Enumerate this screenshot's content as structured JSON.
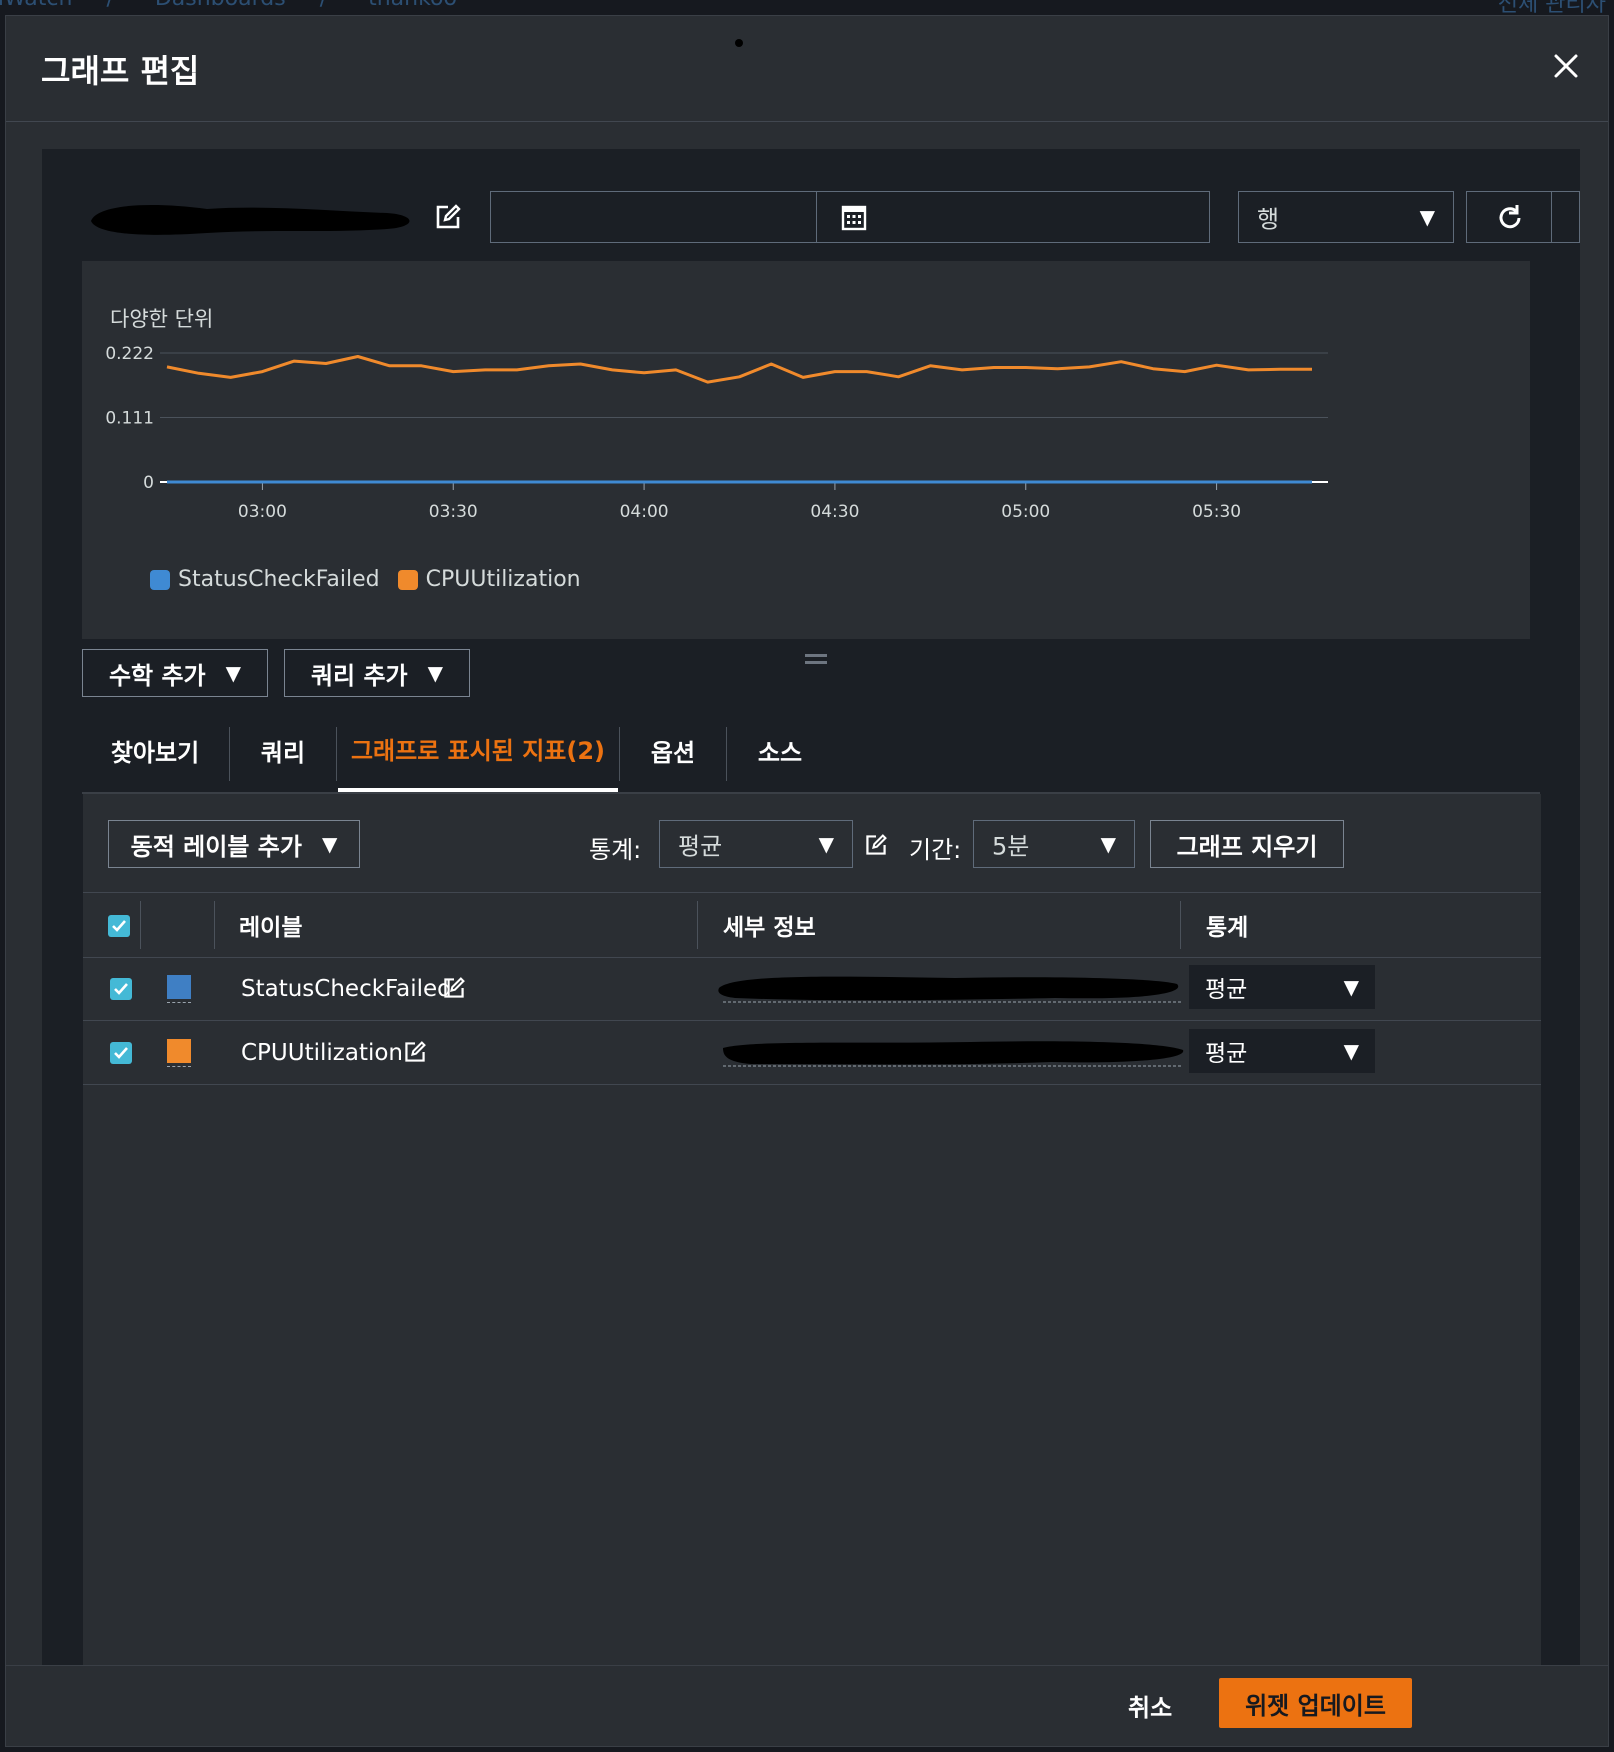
{
  "background": {
    "breadcrumb": [
      "uWatch",
      "Dashboards",
      "thankoo"
    ],
    "top_right": "전체 관리자"
  },
  "modal": {
    "title": "그래프 편집",
    "close_icon": "close-icon"
  },
  "toolbar": {
    "period_select": "행",
    "edit_title_icon": "edit-icon",
    "calendar_icon": "calendar-icon",
    "refresh_icon": "refresh-icon"
  },
  "chart_data": {
    "type": "line",
    "title": "다양한 단위",
    "x": [
      "02:45",
      "02:50",
      "02:55",
      "03:00",
      "03:05",
      "03:10",
      "03:15",
      "03:20",
      "03:25",
      "03:30",
      "03:35",
      "03:40",
      "03:45",
      "03:50",
      "03:55",
      "04:00",
      "04:05",
      "04:10",
      "04:15",
      "04:20",
      "04:25",
      "04:30",
      "04:35",
      "04:40",
      "04:45",
      "04:50",
      "04:55",
      "05:00",
      "05:05",
      "05:10",
      "05:15",
      "05:20",
      "05:25",
      "05:30",
      "05:35",
      "05:40",
      "05:45"
    ],
    "xticks": [
      "03:00",
      "03:30",
      "04:00",
      "04:30",
      "05:00",
      "05:30"
    ],
    "yticks": [
      "0",
      "0.111",
      "0.222"
    ],
    "ylim": [
      0,
      0.222
    ],
    "grid": true,
    "series": [
      {
        "name": "StatusCheckFailed",
        "color": "#3f8ad3",
        "values": [
          0,
          0,
          0,
          0,
          0,
          0,
          0,
          0,
          0,
          0,
          0,
          0,
          0,
          0,
          0,
          0,
          0,
          0,
          0,
          0,
          0,
          0,
          0,
          0,
          0,
          0,
          0,
          0,
          0,
          0,
          0,
          0,
          0,
          0,
          0,
          0,
          0
        ]
      },
      {
        "name": "CPUUtilization",
        "color": "#f08a2c",
        "values": [
          0.198,
          0.187,
          0.18,
          0.19,
          0.208,
          0.204,
          0.216,
          0.2,
          0.2,
          0.19,
          0.193,
          0.193,
          0.2,
          0.203,
          0.193,
          0.188,
          0.193,
          0.172,
          0.181,
          0.203,
          0.18,
          0.19,
          0.19,
          0.181,
          0.2,
          0.193,
          0.197,
          0.197,
          0.195,
          0.198,
          0.207,
          0.195,
          0.19,
          0.201,
          0.193,
          0.194,
          0.194
        ]
      }
    ],
    "legend_position": "bottom-left"
  },
  "actions": {
    "add_math": "수학 추가",
    "add_query": "쿼리 추가"
  },
  "tabs": [
    {
      "label": "찾아보기"
    },
    {
      "label": "쿼리"
    },
    {
      "label": "그래프로 표시된 지표(2)"
    },
    {
      "label": "옵션"
    },
    {
      "label": "소스"
    }
  ],
  "metrics_toolbar": {
    "dynamic_label": "동적 레이블 추가",
    "stat_label": "통계:",
    "stat_value": "평균",
    "period_label": "기간:",
    "period_value": "5분",
    "clear_graph": "그래프 지우기"
  },
  "table": {
    "headers": {
      "label": "레이블",
      "details": "세부 정보",
      "stat": "통계"
    },
    "rows": [
      {
        "label": "StatusCheckFailed",
        "color": "#3f7fc4",
        "stat": "평균"
      },
      {
        "label": "CPUUtilization",
        "color": "#f08a2c",
        "stat": "평균"
      }
    ]
  },
  "footer": {
    "cancel": "취소",
    "update": "위젯 업데이트"
  }
}
